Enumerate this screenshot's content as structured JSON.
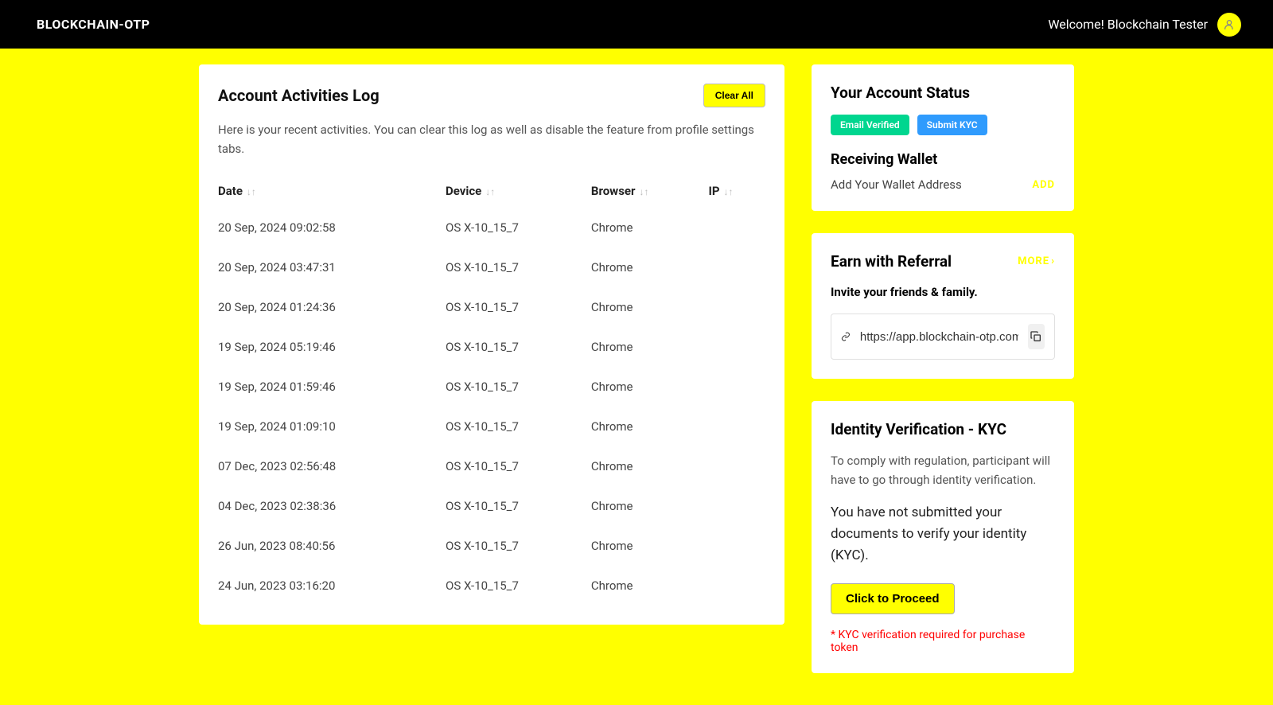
{
  "header": {
    "logo": "BLOCKCHAIN-OTP",
    "welcome": "Welcome! Blockchain Tester"
  },
  "activities": {
    "title": "Account Activities Log",
    "clear_button": "Clear All",
    "subtitle": "Here is your recent activities. You can clear this log as well as disable the feature from profile settings tabs.",
    "columns": {
      "date": "Date",
      "device": "Device",
      "browser": "Browser",
      "ip": "IP"
    },
    "rows": [
      {
        "date": "20 Sep, 2024 09:02:58",
        "device": "OS X-10_15_7",
        "browser": "Chrome",
        "ip": ""
      },
      {
        "date": "20 Sep, 2024 03:47:31",
        "device": "OS X-10_15_7",
        "browser": "Chrome",
        "ip": ""
      },
      {
        "date": "20 Sep, 2024 01:24:36",
        "device": "OS X-10_15_7",
        "browser": "Chrome",
        "ip": ""
      },
      {
        "date": "19 Sep, 2024 05:19:46",
        "device": "OS X-10_15_7",
        "browser": "Chrome",
        "ip": ""
      },
      {
        "date": "19 Sep, 2024 01:59:46",
        "device": "OS X-10_15_7",
        "browser": "Chrome",
        "ip": ""
      },
      {
        "date": "19 Sep, 2024 01:09:10",
        "device": "OS X-10_15_7",
        "browser": "Chrome",
        "ip": ""
      },
      {
        "date": "07 Dec, 2023 02:56:48",
        "device": "OS X-10_15_7",
        "browser": "Chrome",
        "ip": ""
      },
      {
        "date": "04 Dec, 2023 02:38:36",
        "device": "OS X-10_15_7",
        "browser": "Chrome",
        "ip": ""
      },
      {
        "date": "26 Jun, 2023 08:40:56",
        "device": "OS X-10_15_7",
        "browser": "Chrome",
        "ip": ""
      },
      {
        "date": "24 Jun, 2023 03:16:20",
        "device": "OS X-10_15_7",
        "browser": "Chrome",
        "ip": ""
      }
    ]
  },
  "account_status": {
    "title": "Your Account Status",
    "email_badge": "Email Verified",
    "kyc_badge": "Submit KYC",
    "wallet_title": "Receiving Wallet",
    "wallet_text": "Add Your Wallet Address",
    "add_link": "ADD"
  },
  "referral": {
    "title": "Earn with Referral",
    "more": "MORE",
    "invite": "Invite your friends & family.",
    "url": "https://app.blockchain-otp.com"
  },
  "kyc": {
    "title": "Identity Verification - KYC",
    "desc": "To comply with regulation, participant will have to go through identity verification.",
    "status": "You have not submitted your documents to verify your identity (KYC).",
    "proceed": "Click to Proceed",
    "note": "* KYC verification required for purchase token"
  }
}
